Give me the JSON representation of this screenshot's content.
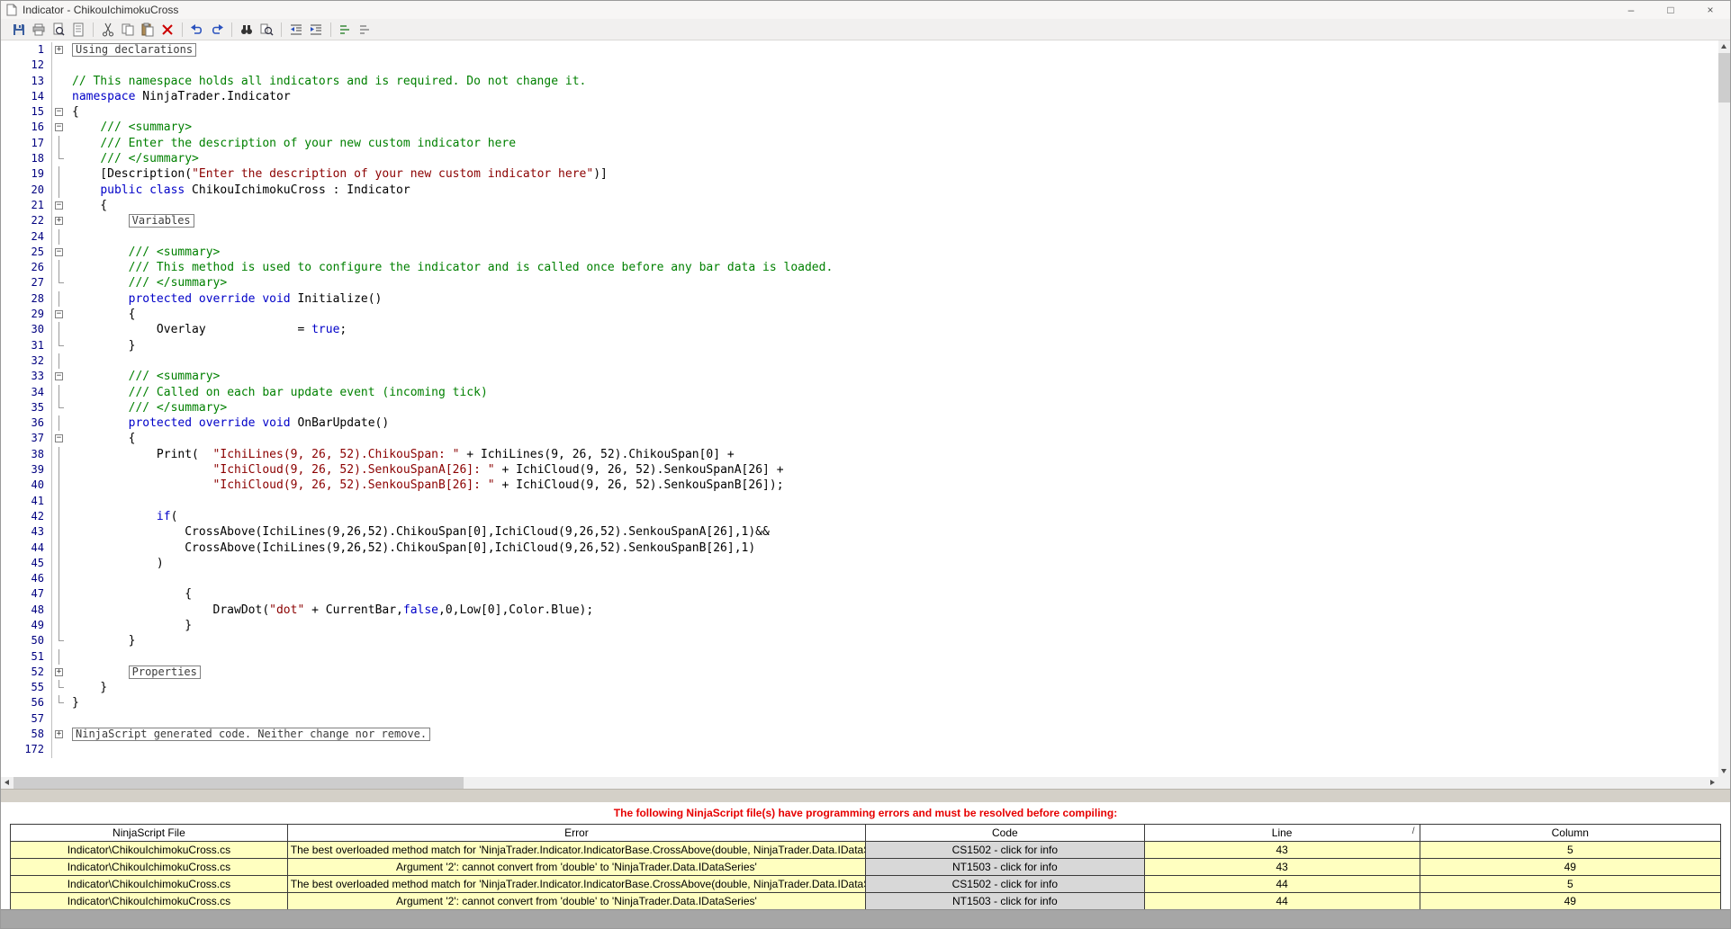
{
  "window": {
    "title": "Indicator - ChikouIchimokuCross",
    "controls": {
      "minimize": "–",
      "maximize": "□",
      "close": "×"
    }
  },
  "toolbar": {
    "groups": [
      [
        "save-icon",
        "print-icon",
        "print-preview-icon",
        "page-properties-icon"
      ],
      [
        "cut-icon",
        "copy-icon",
        "paste-icon",
        "delete-icon"
      ],
      [
        "undo-icon",
        "redo-icon"
      ],
      [
        "find-icon",
        "find-in-files-icon"
      ],
      [
        "outdent-icon",
        "indent-icon"
      ],
      [
        "comment-icon",
        "uncomment-icon"
      ]
    ]
  },
  "editor": {
    "lines": [
      {
        "n": 1,
        "f": "plus",
        "s": [
          [
            "b",
            "Using declarations"
          ]
        ]
      },
      {
        "n": 12,
        "f": "",
        "s": []
      },
      {
        "n": 13,
        "f": "",
        "s": [
          [
            "c",
            "// This namespace holds all indicators and is required. Do not change it."
          ]
        ]
      },
      {
        "n": 14,
        "f": "",
        "s": [
          [
            "k",
            "namespace"
          ],
          [
            "p",
            " NinjaTrader.Indicator"
          ]
        ]
      },
      {
        "n": 15,
        "f": "minus",
        "s": [
          [
            "p",
            "{"
          ]
        ]
      },
      {
        "n": 16,
        "f": "minus",
        "s": [
          [
            "p",
            "    "
          ],
          [
            "c",
            "/// <summary>"
          ]
        ]
      },
      {
        "n": 17,
        "f": "line",
        "s": [
          [
            "p",
            "    "
          ],
          [
            "c",
            "/// Enter the description of your new custom indicator here"
          ]
        ]
      },
      {
        "n": 18,
        "f": "end",
        "s": [
          [
            "p",
            "    "
          ],
          [
            "c",
            "/// </summary>"
          ]
        ]
      },
      {
        "n": 19,
        "f": "line",
        "s": [
          [
            "p",
            "    [Description("
          ],
          [
            "s",
            "\"Enter the description of your new custom indicator here\""
          ],
          [
            "p",
            ")]"
          ]
        ]
      },
      {
        "n": 20,
        "f": "line",
        "s": [
          [
            "p",
            "    "
          ],
          [
            "k",
            "public class"
          ],
          [
            "p",
            " ChikouIchimokuCross : Indicator"
          ]
        ]
      },
      {
        "n": 21,
        "f": "minus",
        "s": [
          [
            "p",
            "    {"
          ]
        ]
      },
      {
        "n": 22,
        "f": "plus",
        "s": [
          [
            "p",
            "        "
          ],
          [
            "b",
            "Variables"
          ]
        ]
      },
      {
        "n": 24,
        "f": "line",
        "s": []
      },
      {
        "n": 25,
        "f": "minus",
        "s": [
          [
            "p",
            "        "
          ],
          [
            "c",
            "/// <summary>"
          ]
        ]
      },
      {
        "n": 26,
        "f": "line",
        "s": [
          [
            "p",
            "        "
          ],
          [
            "c",
            "/// This method is used to configure the indicator and is called once before any bar data is loaded."
          ]
        ]
      },
      {
        "n": 27,
        "f": "end",
        "s": [
          [
            "p",
            "        "
          ],
          [
            "c",
            "/// </summary>"
          ]
        ]
      },
      {
        "n": 28,
        "f": "line",
        "s": [
          [
            "p",
            "        "
          ],
          [
            "k",
            "protected override void"
          ],
          [
            "p",
            " Initialize()"
          ]
        ]
      },
      {
        "n": 29,
        "f": "minus",
        "s": [
          [
            "p",
            "        {"
          ]
        ]
      },
      {
        "n": 30,
        "f": "line",
        "s": [
          [
            "p",
            "            Overlay             = "
          ],
          [
            "k",
            "true"
          ],
          [
            "p",
            ";"
          ]
        ]
      },
      {
        "n": 31,
        "f": "end",
        "s": [
          [
            "p",
            "        }"
          ]
        ]
      },
      {
        "n": 32,
        "f": "line",
        "s": []
      },
      {
        "n": 33,
        "f": "minus",
        "s": [
          [
            "p",
            "        "
          ],
          [
            "c",
            "/// <summary>"
          ]
        ]
      },
      {
        "n": 34,
        "f": "line",
        "s": [
          [
            "p",
            "        "
          ],
          [
            "c",
            "/// Called on each bar update event (incoming tick)"
          ]
        ]
      },
      {
        "n": 35,
        "f": "end",
        "s": [
          [
            "p",
            "        "
          ],
          [
            "c",
            "/// </summary>"
          ]
        ]
      },
      {
        "n": 36,
        "f": "line",
        "s": [
          [
            "p",
            "        "
          ],
          [
            "k",
            "protected override void"
          ],
          [
            "p",
            " OnBarUpdate()"
          ]
        ]
      },
      {
        "n": 37,
        "f": "minus",
        "s": [
          [
            "p",
            "        {"
          ]
        ]
      },
      {
        "n": 38,
        "f": "line",
        "s": [
          [
            "p",
            "            Print(  "
          ],
          [
            "s",
            "\"IchiLines(9, 26, 52).ChikouSpan: \""
          ],
          [
            "p",
            " + IchiLines(9, 26, 52).ChikouSpan[0] +"
          ]
        ]
      },
      {
        "n": 39,
        "f": "line",
        "s": [
          [
            "p",
            "                    "
          ],
          [
            "s",
            "\"IchiCloud(9, 26, 52).SenkouSpanA[26]: \""
          ],
          [
            "p",
            " + IchiCloud(9, 26, 52).SenkouSpanA[26] +"
          ]
        ]
      },
      {
        "n": 40,
        "f": "line",
        "s": [
          [
            "p",
            "                    "
          ],
          [
            "s",
            "\"IchiCloud(9, 26, 52).SenkouSpanB[26]: \""
          ],
          [
            "p",
            " + IchiCloud(9, 26, 52).SenkouSpanB[26]);"
          ]
        ]
      },
      {
        "n": 41,
        "f": "line",
        "s": []
      },
      {
        "n": 42,
        "f": "line",
        "s": [
          [
            "p",
            "            "
          ],
          [
            "k",
            "if"
          ],
          [
            "p",
            "("
          ]
        ]
      },
      {
        "n": 43,
        "f": "line",
        "s": [
          [
            "p",
            "                CrossAbove(IchiLines(9,26,52).ChikouSpan[0],IchiCloud(9,26,52).SenkouSpanA[26],1)&&"
          ]
        ]
      },
      {
        "n": 44,
        "f": "line",
        "s": [
          [
            "p",
            "                CrossAbove(IchiLines(9,26,52).ChikouSpan[0],IchiCloud(9,26,52).SenkouSpanB[26],1)"
          ]
        ]
      },
      {
        "n": 45,
        "f": "line",
        "s": [
          [
            "p",
            "            )"
          ]
        ]
      },
      {
        "n": 46,
        "f": "line",
        "s": []
      },
      {
        "n": 47,
        "f": "line",
        "s": [
          [
            "p",
            "                {"
          ]
        ]
      },
      {
        "n": 48,
        "f": "line",
        "s": [
          [
            "p",
            "                    DrawDot("
          ],
          [
            "s",
            "\"dot\""
          ],
          [
            "p",
            " + CurrentBar,"
          ],
          [
            "k",
            "false"
          ],
          [
            "p",
            ",0,Low[0],Color.Blue);"
          ]
        ]
      },
      {
        "n": 49,
        "f": "line",
        "s": [
          [
            "p",
            "                }"
          ]
        ]
      },
      {
        "n": 50,
        "f": "end",
        "s": [
          [
            "p",
            "        }"
          ]
        ]
      },
      {
        "n": 51,
        "f": "line",
        "s": []
      },
      {
        "n": 52,
        "f": "plus",
        "s": [
          [
            "p",
            "        "
          ],
          [
            "b",
            "Properties"
          ]
        ]
      },
      {
        "n": 55,
        "f": "end",
        "s": [
          [
            "p",
            "    }"
          ]
        ]
      },
      {
        "n": 56,
        "f": "end",
        "s": [
          [
            "p",
            "}"
          ]
        ]
      },
      {
        "n": 57,
        "f": "",
        "s": []
      },
      {
        "n": 58,
        "f": "plus",
        "s": [
          [
            "b",
            "NinjaScript generated code. Neither change nor remove."
          ]
        ]
      },
      {
        "n": 172,
        "f": "",
        "s": []
      }
    ]
  },
  "errors": {
    "notice": "The following NinjaScript file(s) have programming errors and must be resolved before compiling:",
    "columns": [
      "NinjaScript File",
      "Error",
      "Code",
      "Line",
      "Column"
    ],
    "sort_glyph": "/",
    "rows": [
      {
        "file": "Indicator\\ChikouIchimokuCross.cs",
        "error": "The best overloaded method match for 'NinjaTrader.Indicator.IndicatorBase.CrossAbove(double, NinjaTrader.Data.IDataSeries",
        "code": "CS1502 - click for info",
        "line": "43",
        "column": "5"
      },
      {
        "file": "Indicator\\ChikouIchimokuCross.cs",
        "error": "Argument '2': cannot convert from 'double' to 'NinjaTrader.Data.IDataSeries'",
        "code": "NT1503 - click for info",
        "line": "43",
        "column": "49"
      },
      {
        "file": "Indicator\\ChikouIchimokuCross.cs",
        "error": "The best overloaded method match for 'NinjaTrader.Indicator.IndicatorBase.CrossAbove(double, NinjaTrader.Data.IDataSeries",
        "code": "CS1502 - click for info",
        "line": "44",
        "column": "5"
      },
      {
        "file": "Indicator\\ChikouIchimokuCross.cs",
        "error": "Argument '2': cannot convert from 'double' to 'NinjaTrader.Data.IDataSeries'",
        "code": "NT1503 - click for info",
        "line": "44",
        "column": "49"
      }
    ]
  },
  "colors": {
    "keyword": "#0000C8",
    "comment": "#008000",
    "string": "#8B0000",
    "line-number": "#000080",
    "error-accent": "#E60000",
    "row-bg": "#FFFFC0"
  }
}
